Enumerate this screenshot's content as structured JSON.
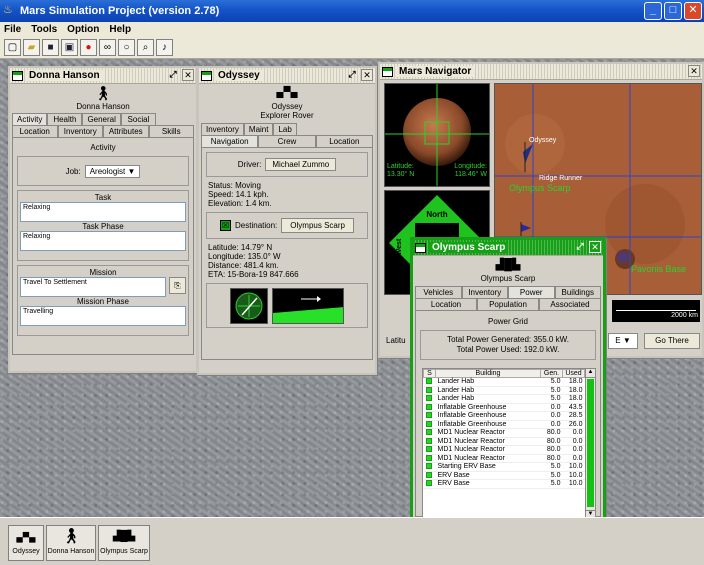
{
  "app": {
    "title": "Mars Simulation Project (version 2.78)",
    "menu": [
      "File",
      "Tools",
      "Option",
      "Help"
    ],
    "toolbar_icons": [
      "new-icon",
      "open-icon",
      "save-icon",
      "save-as-icon",
      "mars-icon",
      "binoculars-icon",
      "globe-icon",
      "search-icon",
      "sound-icon"
    ]
  },
  "donna": {
    "title": "Donna Hanson",
    "name": "Donna Hanson",
    "tabs_row1": [
      "Activity",
      "Health",
      "General",
      "Social"
    ],
    "tabs_row2": [
      "Location",
      "Inventory",
      "Attributes",
      "Skills"
    ],
    "section": "Activity",
    "job_label": "Job:",
    "job_value": "Areologist",
    "task_label": "Task",
    "task_value": "Relaxing",
    "task_phase_label": "Task Phase",
    "task_phase_value": "Relaxing",
    "mission_label": "Mission",
    "mission_value": "Travel To Settlement",
    "mission_phase_label": "Mission Phase",
    "mission_phase_value": "Travelling"
  },
  "odyssey": {
    "title": "Odyssey",
    "name": "Odyssey",
    "type": "Explorer Rover",
    "tabs_row1": [
      "Inventory",
      "Maint",
      "Lab"
    ],
    "tabs_row2": [
      "Navigation",
      "Crew",
      "Location"
    ],
    "driver_label": "Driver:",
    "driver_value": "Michael Zummo",
    "status": "Status: Moving",
    "speed": "Speed: 14.1 kph.",
    "elevation": "Elevation: 1.4 km.",
    "destination_label": "Destination:",
    "destination_value": "Olympus Scarp",
    "latitude": "Latitude: 14.79° N",
    "longitude": "Longitude: 135.0° W",
    "distance": "Distance: 481.4 km.",
    "eta": "ETA: 15-Bora-19  847.666"
  },
  "navigator": {
    "title": "Mars Navigator",
    "lat_label": "Latitude:",
    "lat_value": "13.30° N",
    "lon_label": "Longitude:",
    "lon_value": "118.46° W",
    "compass": {
      "north": "North",
      "west": "West"
    },
    "map_labels": [
      "Odyssey",
      "Ridge Runner",
      "Olympus Scarp",
      "Pavonis Base"
    ],
    "scale": "2000 km",
    "lat_short": "Latitu",
    "dir": "E",
    "go_button": "Go There"
  },
  "olympus": {
    "title": "Olympus Scarp",
    "name": "Olympus Scarp",
    "tabs_row1": [
      "Vehicles",
      "Inventory",
      "Power",
      "Buildings"
    ],
    "tabs_row2": [
      "Location",
      "Population",
      "Associated"
    ],
    "section": "Power Grid",
    "generated": "Total Power Generated: 355.0 kW.",
    "used": "Total Power Used: 192.0 kW.",
    "columns": [
      "S",
      "Building",
      "Gen.",
      "Used"
    ],
    "rows": [
      [
        "Lander Hab",
        "5.0",
        "18.0"
      ],
      [
        "Lander Hab",
        "5.0",
        "18.0"
      ],
      [
        "Lander Hab",
        "5.0",
        "18.0"
      ],
      [
        "Inflatable Greenhouse",
        "0.0",
        "43.5"
      ],
      [
        "Inflatable Greenhouse",
        "0.0",
        "28.5"
      ],
      [
        "Inflatable Greenhouse",
        "0.0",
        "26.0"
      ],
      [
        "MD1 Nuclear Reactor",
        "80.0",
        "0.0"
      ],
      [
        "MD1 Nuclear Reactor",
        "80.0",
        "0.0"
      ],
      [
        "MD1 Nuclear Reactor",
        "80.0",
        "0.0"
      ],
      [
        "MD1 Nuclear Reactor",
        "80.0",
        "0.0"
      ],
      [
        "Starting ERV Base",
        "5.0",
        "10.0"
      ],
      [
        "ERV Base",
        "5.0",
        "10.0"
      ],
      [
        "ERV Base",
        "5.0",
        "10.0"
      ]
    ]
  },
  "dock": [
    {
      "label": "Odyssey",
      "icon": "rover-icon"
    },
    {
      "label": "Donna Hanson",
      "icon": "person-icon"
    },
    {
      "label": "Olympus Scarp",
      "icon": "settlement-icon"
    }
  ],
  "colors": {
    "accent_green": "#16a016",
    "title_blue": "#1554c8"
  }
}
